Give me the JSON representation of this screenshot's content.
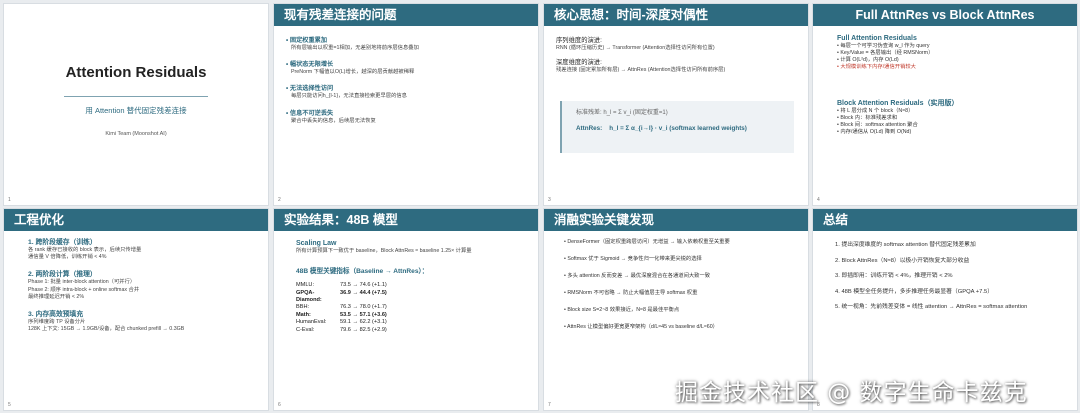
{
  "slides": [
    {
      "num": "1",
      "title": "",
      "main_title": "Attention Residuals",
      "subtitle": "用 Attention 替代固定残差连接",
      "author": "Kimi Team (Moonshot AI)"
    },
    {
      "num": "2",
      "title": "现有残差连接的问题",
      "items": [
        {
          "head": "• 固定权重累加",
          "desc": "所有层输出以权重=1相加，无差别地将前序层信息叠加"
        },
        {
          "head": "• 幅状态无限增长",
          "desc": "PreNorm 下幅值以O(L)增长，越深的层贡献越被稀释"
        },
        {
          "head": "• 无法选择性访问",
          "desc": "每层只能访问h_{l-1}，无法直接检索更早层的信息"
        },
        {
          "head": "• 信息不可逆丢失",
          "desc": "聚合中丢失的信息，后续层无法恢复"
        }
      ]
    },
    {
      "num": "3",
      "title": "核心思想：时间-深度对偶性",
      "seq_head": "序列维度的演进:",
      "seq_line": "RNN (循环压缩历史) → Transformer (Attention选择性访问所有位置)",
      "depth_head": "深度维度的演进:",
      "depth_line": "残差连接 (固定累加所有层) → AttnRes (Attention选择性访问所有前序层)",
      "formula1": "标准残差:  h_l = Σ v_i    (固定权重=1)",
      "formula2_label": "AttnRes:",
      "formula2": "h_l = Σ α_{i→l} · v_i    (softmax learned weights)"
    },
    {
      "num": "4",
      "title": "Full AttnRes vs Block AttnRes",
      "full_head": "Full Attention Residuals",
      "full_items": [
        "• 每层一个可学习伪查询 w_l 作为 query",
        "• Key/Value = 各层输出（经 RMSNorm）",
        "• 计算 O(L²d)，内存 O(Ld)",
        "• 大规模训练下内存/通信开销较大"
      ],
      "block_head": "Block Attention Residuals（实用版）",
      "block_items": [
        "• 将 L 层分成 N 个 block（N≈8）",
        "• Block 内：标准残差求和",
        "• Block 间：softmax attention 聚合",
        "• 内存/通信从 O(Ld) 降到 O(Nd)"
      ]
    },
    {
      "num": "5",
      "title": "工程优化",
      "sections": [
        {
          "head": "1. 跨阶段缓存（训练）",
          "lines": [
            "各 rank 缓存已接收的 block 表示，后续只传增量",
            "通信量 V 倍降低，训练开销 < 4%"
          ]
        },
        {
          "head": "2. 两阶段计算（推理）",
          "lines": [
            "Phase 1: 批量 inter-block attention（可并行）",
            "Phase 2: 顺序 intra-block + online softmax 合并",
            "最终推理延迟开销 < 2%"
          ]
        },
        {
          "head": "3. 内存高效预填充",
          "lines": [
            "序列维度跨 TP 设备分片",
            "128K 上下文: 15GB → 1.9GB/设备，配合 chunked prefill → 0.3GB"
          ]
        }
      ]
    },
    {
      "num": "6",
      "title": "实验结果：48B 模型",
      "scaling_head": "Scaling Law",
      "scaling_line": "所有计算预算下一致优于 baseline，Block AttnRes ≈ baseline 1.25× 计算量",
      "metrics_head": "48B 模型关键指标（Baseline → AttnRes）：",
      "metrics": [
        {
          "name": "MMLU:",
          "value": "73.5 → 74.6 (+1.1)",
          "bold": false
        },
        {
          "name": "GPQA-Diamond:",
          "value": "36.9 → 44.4 (+7.5)",
          "bold": true
        },
        {
          "name": "BBH:",
          "value": "76.3 → 78.0 (+1.7)",
          "bold": false
        },
        {
          "name": "Math:",
          "value": "53.5 → 57.1 (+3.6)",
          "bold": true
        },
        {
          "name": "HumanEval:",
          "value": "59.1 → 62.2 (+3.1)",
          "bold": false
        },
        {
          "name": "C-Eval:",
          "value": "79.6 → 82.5 (+2.9)",
          "bold": false
        }
      ]
    },
    {
      "num": "7",
      "title": "消融实验关键发现",
      "items": [
        "• DenseFormer（固定权重跨层访问）无增益 → 输入依赖权重至关重要",
        "• Softmax 优于 Sigmoid → 竞争性归一化带来更尖锐的选择",
        "• 多头 attention 反而变差 → 最优深度混合在各通道间大致一致",
        "• RMSNorm 不可省略 → 防止大幅值层主导 softmax 权重",
        "• Block size S=2~8 效果接近，N≈8 是最佳平衡点",
        "• AttnRes 让模型偏好更宽更窄架构（d/L≈45 vs baseline d/L≈60）"
      ]
    },
    {
      "num": "8",
      "title": "总结",
      "items": [
        "1. 提出深度维度的 softmax attention 替代固定残差累加",
        "2. Block AttnRes（N≈8）以极小开销恢复大部分收益",
        "3. 即插即用：训练开销 < 4%，推理开销 < 2%",
        "4. 48B 模型全任务提升，多步推理任务最显著（GPQA +7.5）",
        "5. 统一视角：先前残差变体 = 线性 attention → AttnRes = softmax attention"
      ]
    }
  ],
  "watermark": "掘金技术社区 @ 数字生命卡兹克",
  "colors": {
    "accent": "#2e6b80",
    "red": "#c0392b"
  }
}
